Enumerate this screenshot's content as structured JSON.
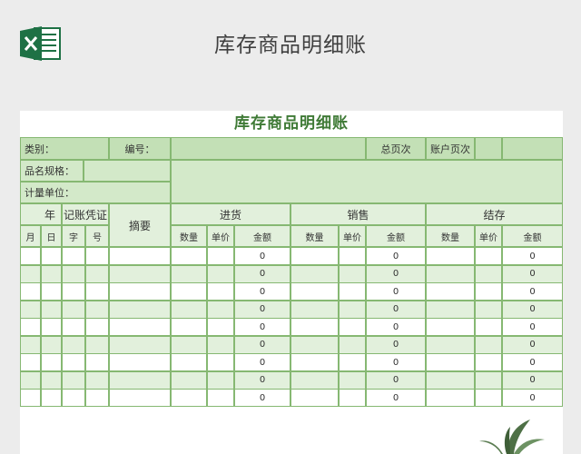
{
  "banner": {
    "title": "库存商品明细账",
    "icon": "excel-icon"
  },
  "sheet": {
    "title": "库存商品明细账",
    "info": {
      "category_label": "类别：",
      "code_label": "编号：",
      "total_page_label": "总页次",
      "account_page_label": "账户页次",
      "spec_label": "品名规格：",
      "unit_label": "计量单位："
    },
    "headers": {
      "year": "年",
      "voucher": "记账凭证",
      "summary": "摘要",
      "month": "月",
      "day": "日",
      "word": "字",
      "number": "号",
      "groups": [
        "进货",
        "销售",
        "结存"
      ],
      "quantity": "数量",
      "unit_price": "单价",
      "amount": "金额"
    },
    "rows": [
      {
        "purchase_amount": "0",
        "sales_amount": "0",
        "balance_amount": "0"
      },
      {
        "purchase_amount": "0",
        "sales_amount": "0",
        "balance_amount": "0"
      },
      {
        "purchase_amount": "0",
        "sales_amount": "0",
        "balance_amount": "0"
      },
      {
        "purchase_amount": "0",
        "sales_amount": "0",
        "balance_amount": "0"
      },
      {
        "purchase_amount": "0",
        "sales_amount": "0",
        "balance_amount": "0"
      },
      {
        "purchase_amount": "0",
        "sales_amount": "0",
        "balance_amount": "0"
      },
      {
        "purchase_amount": "0",
        "sales_amount": "0",
        "balance_amount": "0"
      },
      {
        "purchase_amount": "0",
        "sales_amount": "0",
        "balance_amount": "0"
      },
      {
        "purchase_amount": "0",
        "sales_amount": "0",
        "balance_amount": "0"
      }
    ]
  },
  "colors": {
    "accent": "#3f7a36",
    "border": "#86b872",
    "header_green": "#c3e0b6",
    "row_alt": "#e2f0dc"
  }
}
